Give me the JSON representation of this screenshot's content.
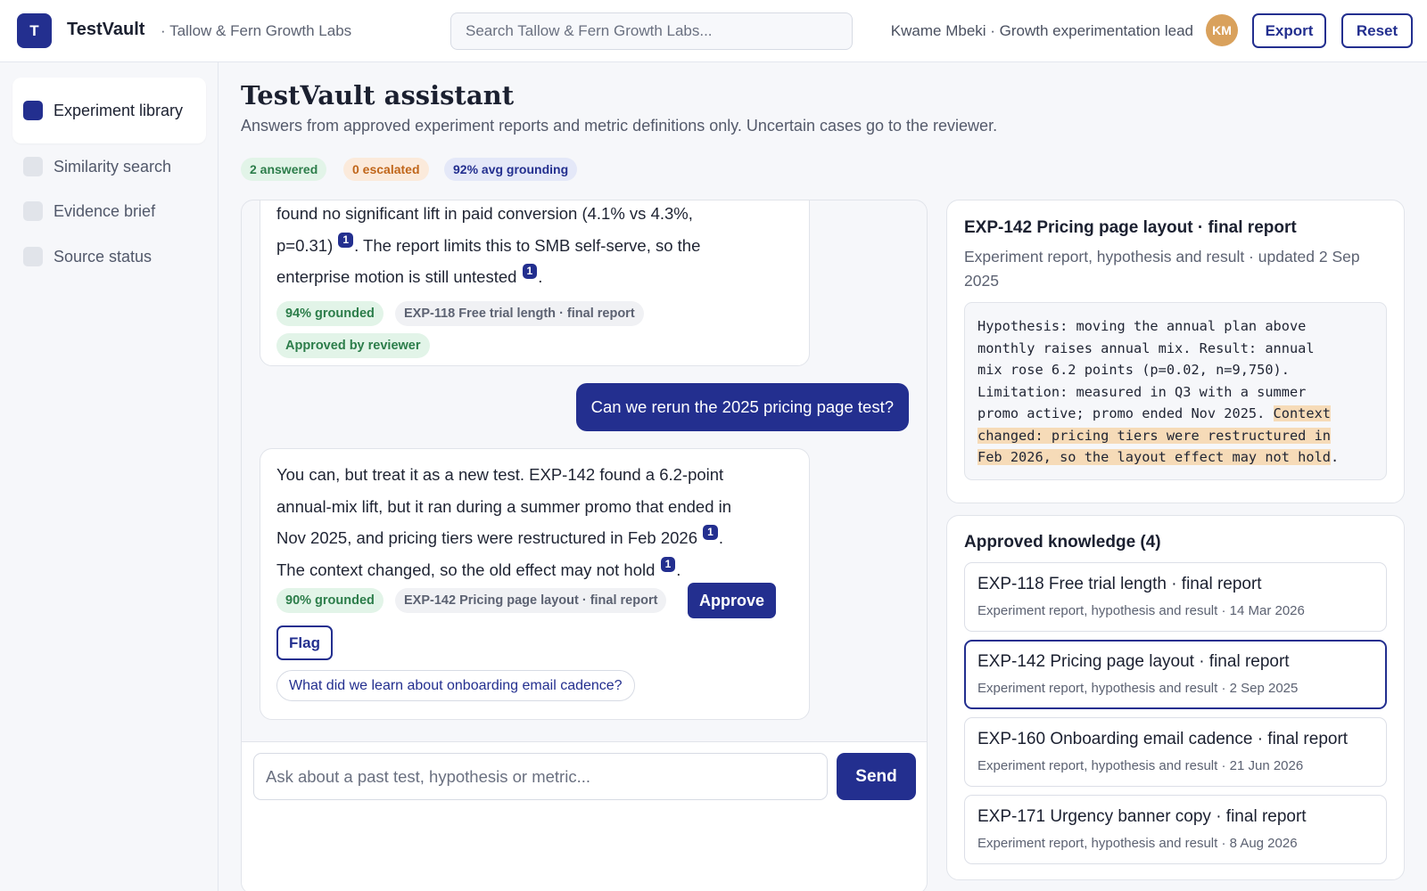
{
  "app": {
    "logo_letter": "T",
    "name": "TestVault",
    "org": "· Tallow & Fern Growth Labs"
  },
  "search": {
    "placeholder": "Search Tallow & Fern Growth Labs..."
  },
  "user": {
    "label": "Kwame Mbeki · Growth experimentation lead",
    "initials": "KM"
  },
  "actions": {
    "export": "Export",
    "reset": "Reset"
  },
  "sidebar": {
    "items": [
      {
        "label": "Experiment library",
        "active": true
      },
      {
        "label": "Similarity search",
        "active": false
      },
      {
        "label": "Evidence brief",
        "active": false
      },
      {
        "label": "Source status",
        "active": false
      }
    ]
  },
  "page": {
    "title": "TestVault assistant",
    "subtitle": "Answers from approved experiment reports and metric definitions only. Uncertain cases go to the reviewer.",
    "stats": {
      "answered": "2 answered",
      "escalated": "0 escalated",
      "grounding": "92% avg grounding"
    }
  },
  "colors": {
    "accent": "#232f8f",
    "green_bg": "#e2f4e8",
    "green_fg": "#2c7d4a",
    "orange_bg": "#fbeadb",
    "orange_fg": "#c0661a",
    "blue_bg": "#e4e8f8",
    "highlight": "#f6dbb8"
  },
  "chat": {
    "messages": [
      {
        "role": "assistant",
        "lines": [
          "found no significant lift in paid conversion (4.1% vs 4.3%,",
          "p=0.31)",
          ". The report limits this to SMB self-serve, so the",
          "enterprise motion is still untested",
          "."
        ],
        "citation": "1",
        "grounded": "94% grounded",
        "source": "EXP-118 Free trial length · final report",
        "status": "Approved by reviewer"
      },
      {
        "role": "user",
        "text": "Can we rerun the 2025 pricing page test?"
      },
      {
        "role": "assistant",
        "lines": [
          "You can, but treat it as a new test. EXP-142 found a 6.2-point",
          "annual-mix lift, but it ran during a summer promo that ended in",
          "Nov 2025, and pricing tiers were restructured in Feb 2026",
          ".",
          "The context changed, so the old effect may not hold",
          "."
        ],
        "citation": "1",
        "grounded": "90% grounded",
        "source": "EXP-142 Pricing page layout · final report",
        "approve": "Approve",
        "flag": "Flag",
        "suggestion": "What did we learn about onboarding email cadence?"
      }
    ],
    "composer": {
      "placeholder": "Ask about a past test, hypothesis or metric...",
      "send": "Send"
    }
  },
  "source_panel": {
    "title": "EXP-142 Pricing page layout · final report",
    "meta": "Experiment report, hypothesis and result · updated 2 Sep 2025",
    "excerpt_lines": [
      "Hypothesis: moving the annual plan above",
      "monthly raises annual mix. Result: annual",
      "mix rose 6.2 points (p=0.02, n=9,750).",
      "Limitation: measured in Q3 with a summer",
      "promo active; promo ended Nov 2025. "
    ],
    "excerpt_highlight": [
      "Context",
      "changed: pricing tiers were restructured in",
      "Feb 2026, so the layout effect may not hold"
    ],
    "excerpt_end": "."
  },
  "knowledge": {
    "title": "Approved knowledge (4)",
    "items": [
      {
        "name": "EXP-118 Free trial length · final report",
        "meta": "Experiment report, hypothesis and result · 14 Mar 2026",
        "selected": false
      },
      {
        "name": "EXP-142 Pricing page layout · final report",
        "meta": "Experiment report, hypothesis and result · 2 Sep 2025",
        "selected": true
      },
      {
        "name": "EXP-160 Onboarding email cadence · final report",
        "meta": "Experiment report, hypothesis and result · 21 Jun 2026",
        "selected": false
      },
      {
        "name": "EXP-171 Urgency banner copy · final report",
        "meta": "Experiment report, hypothesis and result · 8 Aug 2026",
        "selected": false
      }
    ]
  }
}
